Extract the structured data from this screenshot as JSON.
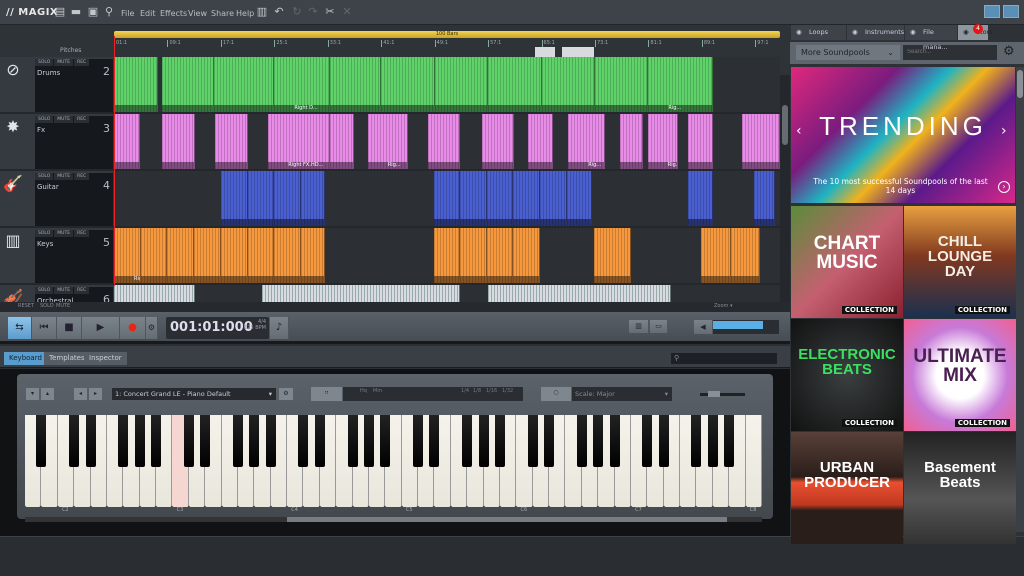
{
  "app": {
    "logo": "MAGIX",
    "menu": [
      "File",
      "Edit",
      "Effects",
      "View",
      "Share",
      "Help"
    ],
    "toolbar_icons": [
      "new-file-icon",
      "open-folder-icon",
      "save-icon",
      "search-icon"
    ],
    "edit_icons": [
      "mixer-icon",
      "undo-icon",
      "redo-icon",
      "redo-alt-icon",
      "scissors-icon",
      "delete-icon"
    ]
  },
  "arrange": {
    "loop_label": "100 Bars",
    "ruler": [
      "01:1",
      "09:1",
      "17:1",
      "25:1",
      "33:1",
      "41:1",
      "49:1",
      "57:1",
      "65:1",
      "73:1",
      "81:1",
      "89:1",
      "97:1"
    ],
    "pitches_label": "Pitches",
    "track_buttons": [
      "SOLO",
      "MUTE",
      "REC"
    ],
    "tracks": [
      {
        "name": "Drums",
        "number": "2",
        "icon": "drum-icon",
        "color": "#5fd36a",
        "clips": [
          [
            1,
            7.6,
            ""
          ],
          [
            8.2,
            16,
            ""
          ],
          [
            16,
            25,
            ""
          ],
          [
            25,
            33.3,
            "Right D..."
          ],
          [
            33.3,
            41,
            ""
          ],
          [
            41,
            49,
            ""
          ],
          [
            49,
            57,
            ""
          ],
          [
            57,
            65,
            ""
          ],
          [
            65,
            73,
            ""
          ],
          [
            73,
            81,
            ""
          ],
          [
            81,
            90.7,
            "Rig..."
          ]
        ]
      },
      {
        "name": "Fx",
        "number": "3",
        "icon": "fx-burst-icon",
        "color": "#e98ce9",
        "clips": [
          [
            1,
            4.9,
            ""
          ],
          [
            8.2,
            13.1,
            ""
          ],
          [
            16.1,
            21.1,
            ""
          ],
          [
            24.1,
            33.3,
            "Right FX.HD..."
          ],
          [
            33.3,
            36.9,
            ""
          ],
          [
            39,
            45,
            "Rig..."
          ],
          [
            48,
            52.8,
            ""
          ],
          [
            56.1,
            60.9,
            ""
          ],
          [
            63,
            66.7,
            ""
          ],
          [
            69,
            74.5,
            "Rig..."
          ],
          [
            76.7,
            80.2,
            ""
          ],
          [
            80.9,
            85.4,
            "Rig..."
          ],
          [
            86.9,
            90.7,
            ""
          ],
          [
            95,
            100.7,
            ""
          ]
        ]
      },
      {
        "name": "Guitar",
        "number": "4",
        "icon": "guitar-icon",
        "color": "#4a5fd0",
        "clips": [
          [
            17,
            21,
            ""
          ],
          [
            21,
            25,
            ""
          ],
          [
            25,
            29,
            ""
          ],
          [
            29,
            32.6,
            ""
          ],
          [
            48.9,
            52.8,
            ""
          ],
          [
            52.8,
            56.8,
            ""
          ],
          [
            56.8,
            60.8,
            ""
          ],
          [
            60.8,
            64.8,
            ""
          ],
          [
            64.8,
            68.8,
            ""
          ],
          [
            68.8,
            72.6,
            ""
          ],
          [
            86.9,
            90.7,
            ""
          ],
          [
            96.8,
            100,
            ""
          ]
        ]
      },
      {
        "name": "Keys",
        "number": "5",
        "icon": "keyboard-icon",
        "color": "#f5983e",
        "clips": [
          [
            1,
            5,
            "Right Ke..."
          ],
          [
            5,
            9,
            ""
          ],
          [
            9,
            13,
            ""
          ],
          [
            13,
            17,
            ""
          ],
          [
            17,
            21,
            ""
          ],
          [
            21,
            25,
            ""
          ],
          [
            25,
            29,
            ""
          ],
          [
            29,
            32.6,
            ""
          ],
          [
            48.9,
            52.8,
            ""
          ],
          [
            52.8,
            56.8,
            ""
          ],
          [
            56.8,
            60.8,
            ""
          ],
          [
            60.8,
            64.8,
            ""
          ],
          [
            72.9,
            78.4,
            ""
          ],
          [
            88.9,
            93.3,
            ""
          ],
          [
            93.3,
            97.7,
            ""
          ]
        ]
      },
      {
        "name": "Orchestral",
        "number": "6",
        "icon": "violin-icon",
        "color": "#d8dbe2",
        "clips": [
          [
            1,
            13.1,
            ""
          ],
          [
            23.2,
            52.8,
            ""
          ],
          [
            57,
            84.4,
            ""
          ]
        ]
      }
    ],
    "footer": [
      "RESET",
      "SOLO",
      "MUTE"
    ],
    "zoom_label": "Zoom ▾"
  },
  "transport": {
    "time": "001:01:000",
    "signature": "4/4",
    "bpm": "125 BPM",
    "volume_percent": 75
  },
  "bottom_tabs": [
    {
      "label": "Keyboard",
      "active": true
    },
    {
      "label": "Templates",
      "active": false
    },
    {
      "label": "Inspector",
      "active": false
    }
  ],
  "keyboard": {
    "preset": "1: Concert Grand LE - Piano Default",
    "scale": "Scale: Major",
    "quantize": [
      "1/4",
      "1/8",
      "1/16",
      "1/32"
    ],
    "mode": [
      "Hq",
      "Mm"
    ],
    "octave_labels": [
      "C2",
      "C3",
      "C4",
      "C5",
      "C6",
      "C7",
      "C8"
    ],
    "highlighted_key": "C3",
    "highlight_color": "#f6d6d0"
  },
  "right": {
    "tabs": [
      {
        "label": "Loops",
        "icon": "loops-icon"
      },
      {
        "label": "Instruments",
        "icon": "instruments-icon"
      },
      {
        "label": "File mana...",
        "icon": "folder-icon"
      },
      {
        "label": "Store",
        "icon": "power-icon",
        "active": true
      }
    ],
    "badge": "4",
    "dropdown": "More Soundpools",
    "search_placeholder": "Search...",
    "banner": {
      "title": "TRENDING",
      "subtitle": "The 10 most successful Soundpools of the last 14 days"
    },
    "tiles": [
      {
        "title": "CHART\nMUSIC",
        "badge": "COLLECTION",
        "bg": "linear-gradient(135deg,#5a8c3a,#c46070 50%,#8a2030)",
        "color": "#fff"
      },
      {
        "title": "CHILL\nLOUNGE\nDAY",
        "badge": "COLLECTION",
        "bg": "linear-gradient(#e8a040,#803820 45%,#1a3050)",
        "color": "#f4efe6"
      },
      {
        "title": "ELECTRONIC\nBEATS",
        "badge": "COLLECTION",
        "bg": "radial-gradient(#3a3f40,#111)",
        "color": "#3be060"
      },
      {
        "title": "ULTIMATE\nMIX",
        "badge": "COLLECTION",
        "bg": "radial-gradient(#fff 30%,#c77ad8 60%,#f06090)",
        "color": "#4a2050"
      },
      {
        "title": "URBAN\nPRODUCER",
        "badge": "",
        "bg": "linear-gradient(#5a4038,#2a1e1a 40%,#e85030 45%,#c03820 65%,#2a1e1a 70%)",
        "color": "#fff"
      },
      {
        "title": "Basement\nBeats",
        "badge": "",
        "bg": "linear-gradient(#222,#555 60%,#333)",
        "color": "#fff"
      }
    ]
  }
}
